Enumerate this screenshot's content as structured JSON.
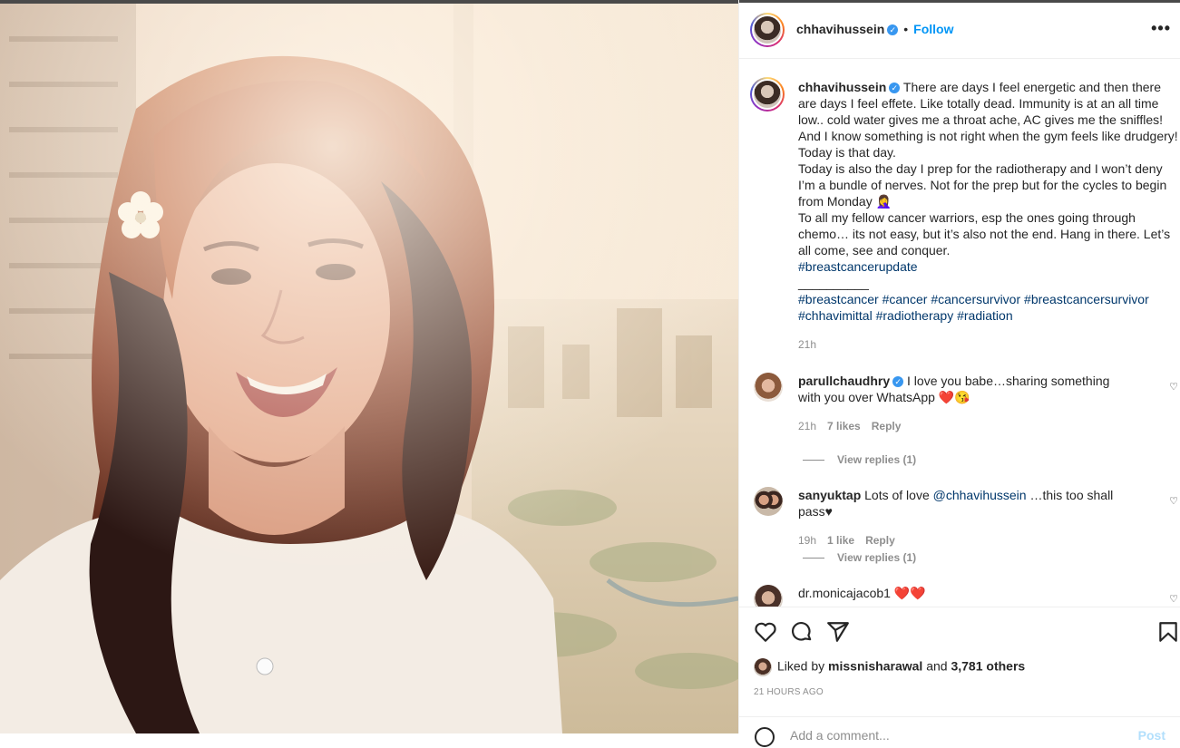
{
  "post": {
    "username": "chhavihussein",
    "follow_label": "Follow",
    "more_label": "•••"
  },
  "caption": {
    "username": "chhavihussein",
    "text_1": "There are days I feel energetic and then there are days I feel effete. Like totally dead. Immunity is at an all time low.. cold water gives me a throat ache, AC gives me the sniffles! And I know something is not right when the gym feels like drudgery!",
    "text_2": "Today is that day.",
    "text_3": "Today is also the day I prep for the radiotherapy and I won’t deny I’m a bundle of nerves. Not for the prep but for the cycles to begin from Monday 🤦‍♀️",
    "text_4": "To all my fellow cancer warriors, esp the ones going through chemo… its not easy, but it’s also not the end. Hang in there. Let’s all come, see and conquer.",
    "hashtag_1": "#breastcancerupdate",
    "separator": "__________",
    "hashtags": [
      "#breastcancer",
      "#cancer",
      "#cancersurvivor",
      "#breastcancersurvivor",
      "#chhavimittal",
      "#radiotherapy",
      "#radiation"
    ],
    "time": "21h"
  },
  "comments": [
    {
      "username": "parullchaudhry",
      "text": "I love you babe…sharing something with you over WhatsApp ❤️😘",
      "time": "21h",
      "likes": "7 likes",
      "reply": "Reply",
      "view_replies": "View replies (1)"
    },
    {
      "username": "sanyuktap",
      "text_pre": "Lots of love",
      "mention": "@chhavihussein",
      "text_post": "…this too shall pass♥",
      "time": "19h",
      "likes": "1 like",
      "reply": "Reply",
      "view_replies": "View replies (1)"
    },
    {
      "username": "dr.monicajacob1",
      "text": "❤️❤️"
    }
  ],
  "likes": {
    "prefix": "Liked by",
    "user": "missnisharawal",
    "and": "and",
    "count": "3,781 others"
  },
  "timestamp": "21 HOURS AGO",
  "add_comment": {
    "placeholder": "Add a comment...",
    "post_label": "Post"
  },
  "icons": [
    "heart-icon",
    "comment-icon",
    "share-icon",
    "save-icon",
    "verified-icon",
    "more-icon"
  ],
  "colors": {
    "link_blue": "#0095f6",
    "hashtag": "#00376b",
    "verified": "#3897f0",
    "muted": "#8e8e8e",
    "heart_red": "#ed4956"
  }
}
